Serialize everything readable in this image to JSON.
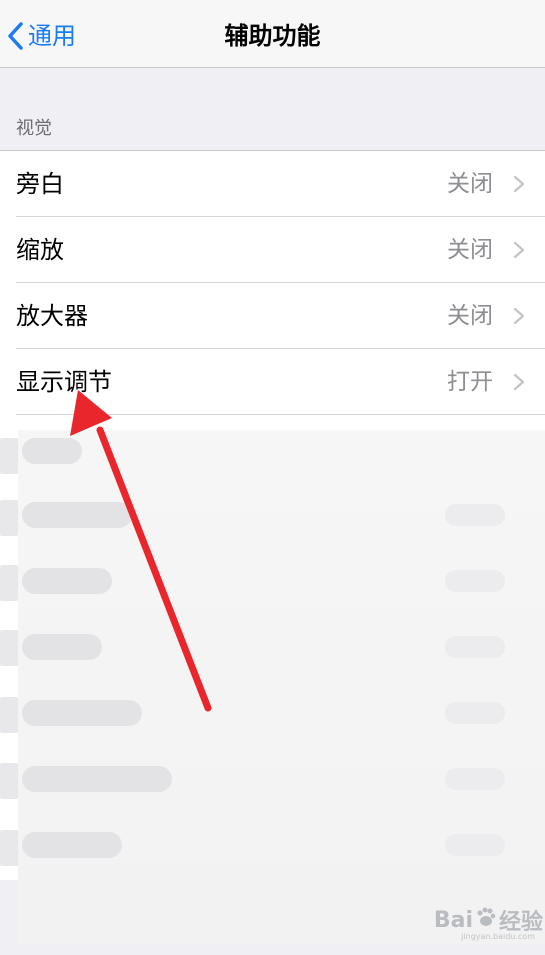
{
  "nav": {
    "back_label": "通用",
    "title": "辅助功能"
  },
  "section": {
    "header": "视觉"
  },
  "rows": [
    {
      "label": "旁白",
      "value": "关闭"
    },
    {
      "label": "缩放",
      "value": "关闭"
    },
    {
      "label": "放大器",
      "value": "关闭"
    },
    {
      "label": "显示调节",
      "value": "打开"
    }
  ],
  "annotation": {
    "arrow_color": "#e8262b"
  },
  "colors": {
    "accent": "#1a7cf5",
    "secondary_text": "#8e8e93",
    "background": "#efeff4"
  },
  "watermark": {
    "brand": "Bai",
    "brand_suffix": "经验",
    "url": "jingyan.baidu.com"
  }
}
